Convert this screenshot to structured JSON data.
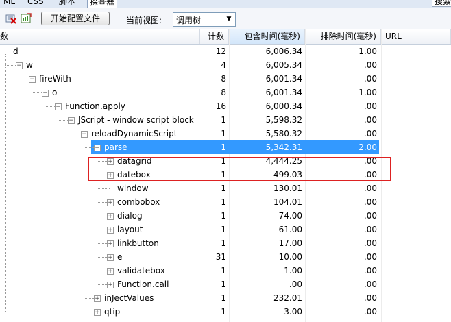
{
  "tabs": [
    {
      "label": "ML",
      "active": false
    },
    {
      "label": "CSS",
      "active": false
    },
    {
      "label": "脚本",
      "active": false
    },
    {
      "label": "探查器",
      "active": true
    }
  ],
  "tab_search": "搜索",
  "toolbar": {
    "icons": [
      "clear-icon",
      "export-icon"
    ],
    "config_button": "开始配置文件",
    "view_label": "当前视图:",
    "view_value": "调用树"
  },
  "columns": {
    "name": "数",
    "count": "计数",
    "inclusive": "包含时间(毫秒)",
    "exclusive": "排除时间(毫秒)",
    "url": "URL"
  },
  "rows": [
    {
      "name": "d",
      "count": "12",
      "inclusive": "6,006.34",
      "exclusive": "1.00"
    },
    {
      "name": "w",
      "count": "4",
      "inclusive": "6,005.34",
      "exclusive": ".00"
    },
    {
      "name": "fireWith",
      "count": "8",
      "inclusive": "6,001.34",
      "exclusive": ".00"
    },
    {
      "name": "o",
      "count": "8",
      "inclusive": "6,001.34",
      "exclusive": "1.00"
    },
    {
      "name": "Function.apply",
      "count": "16",
      "inclusive": "6,000.34",
      "exclusive": ".00"
    },
    {
      "name": "JScript - window script block",
      "count": "1",
      "inclusive": "5,598.32",
      "exclusive": ".00"
    },
    {
      "name": "reloadDynamicScript",
      "count": "1",
      "inclusive": "5,580.32",
      "exclusive": ".00"
    },
    {
      "name": "parse",
      "count": "1",
      "inclusive": "5,342.31",
      "exclusive": "2.00",
      "selected": true
    },
    {
      "name": "datagrid",
      "count": "1",
      "inclusive": "4,444.25",
      "exclusive": ".00"
    },
    {
      "name": "datebox",
      "count": "1",
      "inclusive": "499.03",
      "exclusive": ".00"
    },
    {
      "name": "window",
      "count": "1",
      "inclusive": "130.01",
      "exclusive": ".00"
    },
    {
      "name": "combobox",
      "count": "1",
      "inclusive": "104.01",
      "exclusive": ".00"
    },
    {
      "name": "dialog",
      "count": "1",
      "inclusive": "74.00",
      "exclusive": ".00"
    },
    {
      "name": "layout",
      "count": "1",
      "inclusive": "61.00",
      "exclusive": ".00"
    },
    {
      "name": "linkbutton",
      "count": "1",
      "inclusive": "17.00",
      "exclusive": ".00"
    },
    {
      "name": "e",
      "count": "31",
      "inclusive": "10.00",
      "exclusive": ".00"
    },
    {
      "name": "validatebox",
      "count": "1",
      "inclusive": "1.00",
      "exclusive": ".00"
    },
    {
      "name": "Function.call",
      "count": "1",
      "inclusive": ".00",
      "exclusive": ".00"
    },
    {
      "name": "inJectValues",
      "count": "1",
      "inclusive": "232.01",
      "exclusive": ".00"
    },
    {
      "name": "qtip",
      "count": "1",
      "inclusive": "3.00",
      "exclusive": ".00"
    }
  ],
  "colors": {
    "selection": "#3399ff",
    "highlight_box": "#dd2222"
  }
}
